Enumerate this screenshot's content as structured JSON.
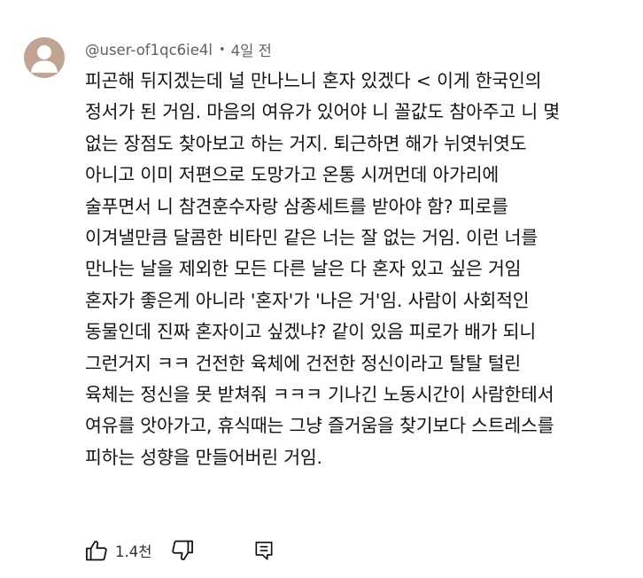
{
  "comment": {
    "author": "@user-of1qc6ie4l",
    "separator": "•",
    "time": "4일 전",
    "lines": [
      "피곤해 뒤지겠는데 널 만나느니 혼자 있겠다 < 이게 한국인의",
      "정서가 된 거임. 마음의 여유가 있어야 니 꼴값도 참아주고 니 몇",
      "없는 장점도 찾아보고 하는 거지. 퇴근하면 해가 뉘엿뉘엿도",
      "아니고 이미 저편으로 도망가고 온통 시꺼먼데 아가리에",
      "술푸면서 니 참견훈수자랑 삼종세트를 받아야 함? 피로를",
      "이겨낼만큼 달콤한 비타민 같은 너는 잘 없는 거임. 이런 너를",
      "만나는 날을 제외한 모든 다른 날은 다 혼자 있고 싶은 거임",
      "혼자가 좋은게 아니라  '혼자'가 '나은 거'임. 사람이 사회적인",
      "동물인데 진짜 혼자이고 싶겠냐? 같이 있음 피로가 배가 되니",
      "그런거지  ㅋㅋ 건전한 육체에 건전한 정신이라고 탈탈 털린",
      "육체는 정신을 못 받쳐줘 ㅋㅋㅋ 기나긴 노동시간이 사람한테서",
      "여유를 앗아가고, 휴식때는 그냥 즐거움을 찾기보다 스트레스를",
      "피하는 성향을 만들어버린 거임."
    ],
    "like_count": "1.4천"
  },
  "icons": {
    "avatar": "default-avatar-icon",
    "like": "thumb-up-icon",
    "dislike": "thumb-down-icon",
    "reply": "reply-icon"
  },
  "colors": {
    "avatar_bg": "#bfa493",
    "avatar_fg": "#ffffff",
    "meta_text": "#606060",
    "body_text": "#131313"
  }
}
